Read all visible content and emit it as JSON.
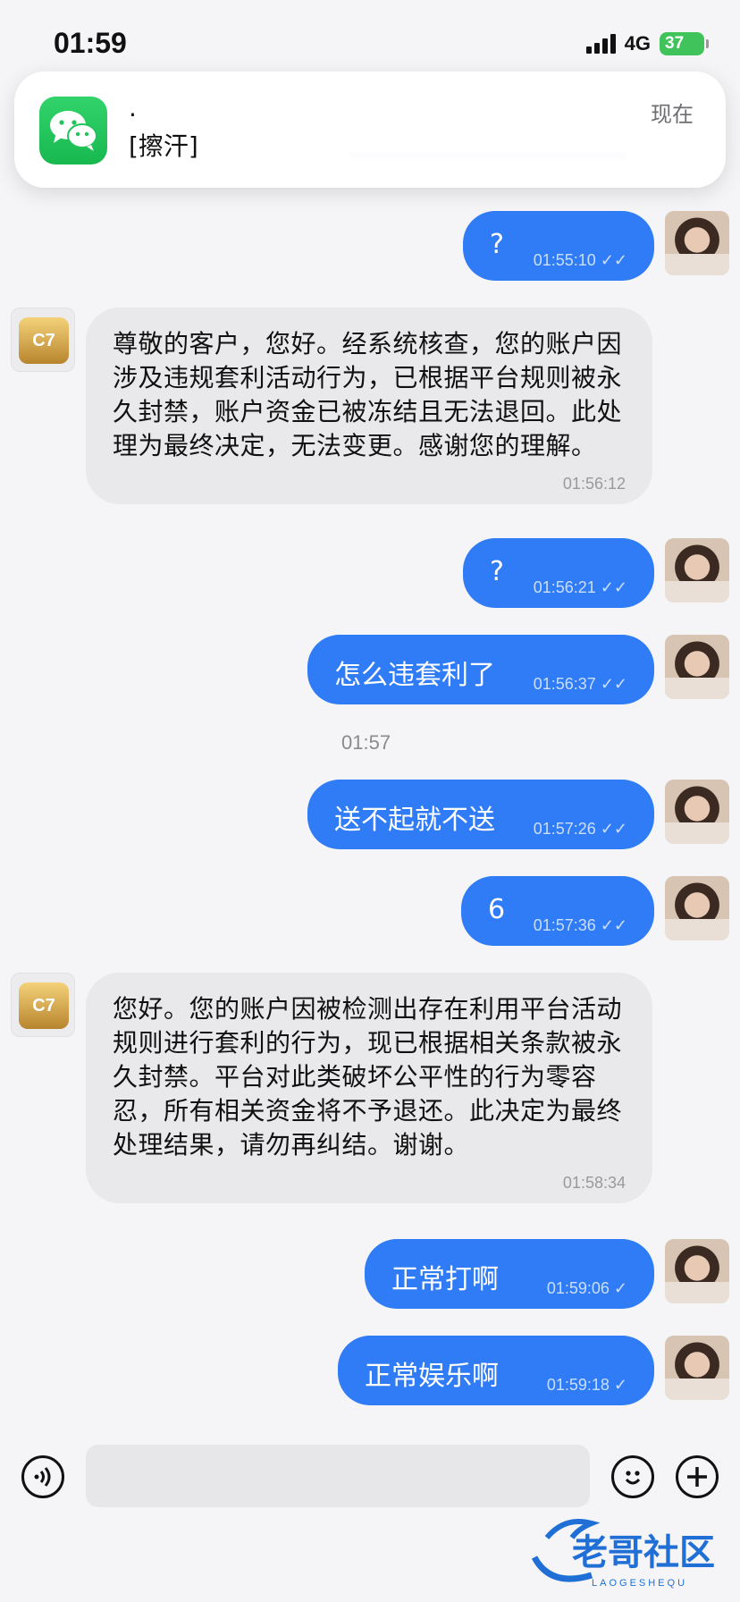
{
  "status": {
    "time": "01:59",
    "network": "4G",
    "battery": "37"
  },
  "notification": {
    "app_icon": "wechat-icon",
    "title": ".",
    "body": "[擦汗]",
    "time": "现在"
  },
  "chat": {
    "divider_time": "01:57",
    "messages": [
      {
        "text": "?",
        "time": "01:55:10"
      },
      {
        "text": "尊敬的客户，您好。经系统核查，您的账户因涉及违规套利活动行为，已根据平台规则被永久封禁，账户资金已被冻结且无法退回。此处理为最终决定，无法变更。感谢您的理解。",
        "time": "01:56:12"
      },
      {
        "text": "?",
        "time": "01:56:21"
      },
      {
        "text": "怎么违套利了",
        "time": "01:56:37"
      },
      {
        "text": "送不起就不送",
        "time": "01:57:26"
      },
      {
        "text": "6",
        "time": "01:57:36"
      },
      {
        "text": "您好。您的账户因被检测出存在利用平台活动规则进行套利的行为，现已根据相关条款被永久封禁。平台对此类破坏公平性的行为零容忍，所有相关资金将不予退还。此决定为最终处理结果，请勿再纠结。谢谢。",
        "time": "01:58:34"
      },
      {
        "text": "正常打啊",
        "time": "01:59:06"
      },
      {
        "text": "正常娱乐啊",
        "time": "01:59:18"
      }
    ]
  },
  "bot_avatar_label": "C7",
  "input": {
    "voice_icon": "voice-icon",
    "emoji_icon": "emoji-icon",
    "plus_icon": "plus-icon"
  },
  "watermark": {
    "text": "老哥社区",
    "subtext": "LAOGESHEQU"
  }
}
